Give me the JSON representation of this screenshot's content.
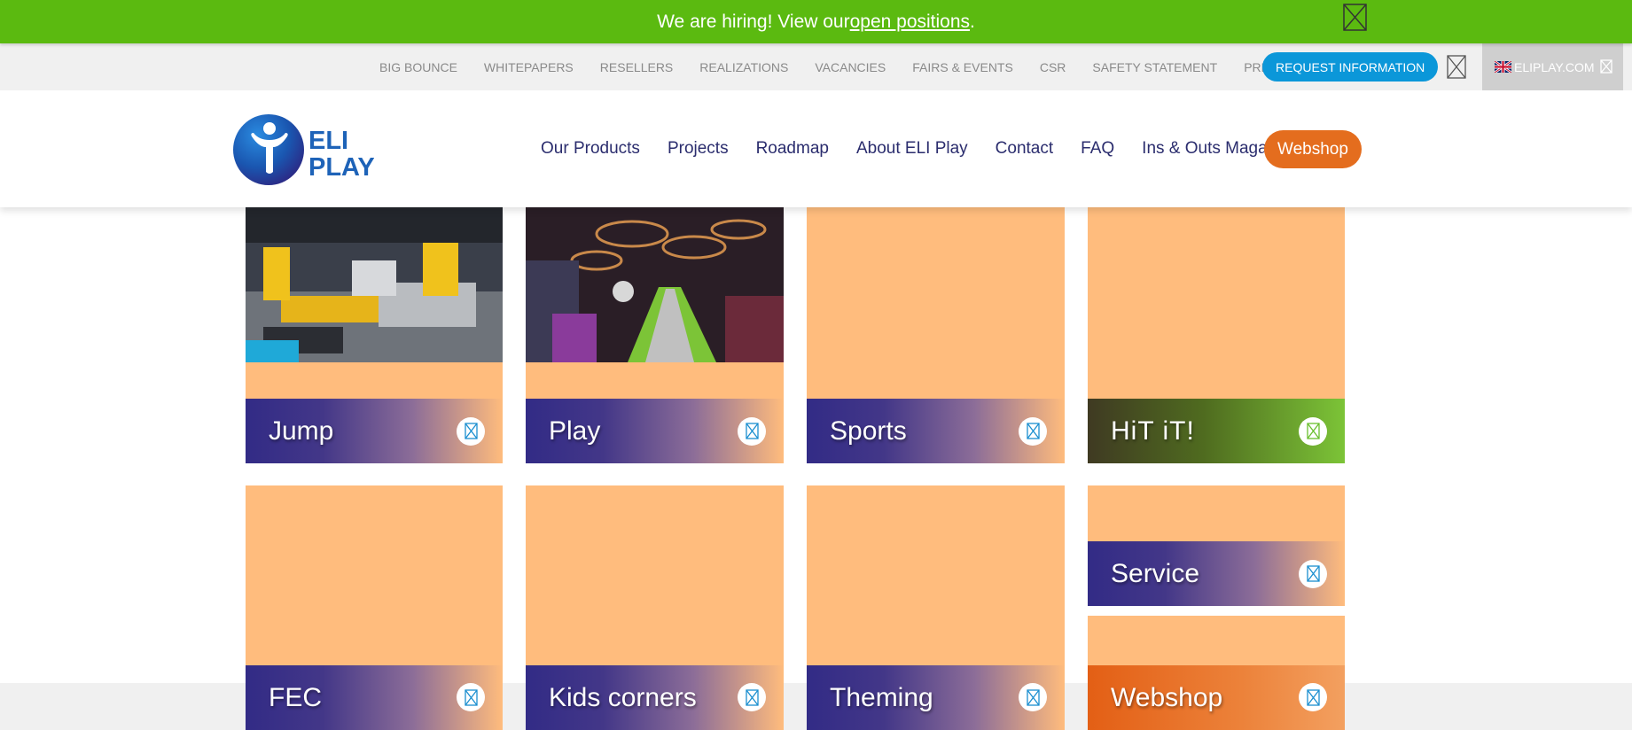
{
  "banner": {
    "text": "We are hiring! View our ",
    "link": "open positions",
    "suffix": "."
  },
  "topbar": {
    "links": [
      "BIG BOUNCE",
      "WHITEPAPERS",
      "RESELLERS",
      "REALIZATIONS",
      "VACANCIES",
      "FAIRS & EVENTS",
      "CSR",
      "SAFETY STATEMENT",
      "PRESS"
    ],
    "request_button": "REQUEST INFORMATION",
    "language": "ELIPLAY.COM"
  },
  "header": {
    "logo_text_line1": "ELI",
    "logo_text_line2": "PLAY",
    "nav": [
      "Our Products",
      "Projects",
      "Roadmap",
      "About ELI Play",
      "Contact",
      "FAQ",
      "Ins & Outs Magazine"
    ],
    "webshop_button": "Webshop"
  },
  "tiles": {
    "jump": "Jump",
    "play": "Play",
    "sports": "Sports",
    "hitit": "HiT iT!",
    "fec": "FEC",
    "kids": "Kids corners",
    "theming": "Theming",
    "service": "Service",
    "webshop": "Webshop"
  },
  "colors": {
    "banner_green": "#5bba10",
    "nav_text": "#2b2d6e",
    "request_blue": "#0b97d9",
    "webshop_orange": "#e46d1e",
    "tile_peach": "#ffbc7d",
    "tile_purple": "#322b86"
  },
  "icons": {
    "tile_action": "broken-image-icon",
    "close": "close-icon",
    "flag": "uk-flag-icon"
  }
}
